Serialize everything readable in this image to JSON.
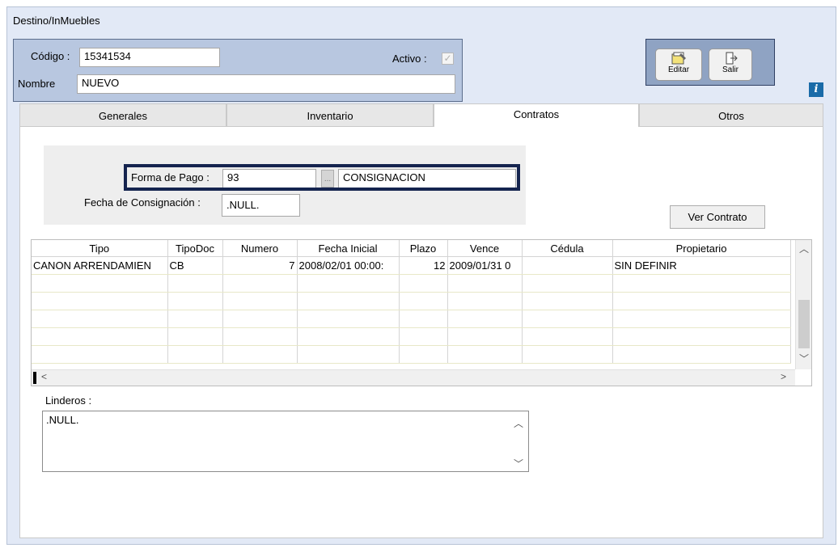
{
  "window": {
    "title": "Destino/InMuebles"
  },
  "header": {
    "codigo_label": "Código :",
    "codigo_value": "15341534",
    "activo_label": "Activo :",
    "activo_checked": true,
    "nombre_label": "Nombre",
    "nombre_value": "NUEVO"
  },
  "actions": {
    "edit_label": "Editar",
    "exit_label": "Salir"
  },
  "info_icon_glyph": "i",
  "tabs": [
    {
      "label": "Generales",
      "active": false
    },
    {
      "label": "Inventario",
      "active": false
    },
    {
      "label": "Contratos",
      "active": true
    },
    {
      "label": "Otros",
      "active": false
    }
  ],
  "payment": {
    "forma_label": "Forma de Pago :",
    "forma_code": "93",
    "ellipsis": "...",
    "forma_desc": "CONSIGNACION",
    "fecha_label": "Fecha de Consignación :",
    "fecha_value": ".NULL."
  },
  "ver_contrato_label": "Ver Contrato",
  "grid": {
    "columns": [
      "Tipo",
      "TipoDoc",
      "Numero",
      "Fecha Inicial",
      "Plazo",
      "Vence",
      "Cédula",
      "Propietario"
    ],
    "rows": [
      [
        "CANON ARRENDAMIEN",
        "CB",
        "7",
        "2008/02/01 00:00:",
        "12",
        "2009/01/31 0",
        "",
        "SIN DEFINIR"
      ],
      [
        "",
        "",
        "",
        "",
        "",
        "",
        "",
        ""
      ],
      [
        "",
        "",
        "",
        "",
        "",
        "",
        "",
        ""
      ],
      [
        "",
        "",
        "",
        "",
        "",
        "",
        "",
        ""
      ],
      [
        "",
        "",
        "",
        "",
        "",
        "",
        "",
        ""
      ],
      [
        "",
        "",
        "",
        "",
        "",
        "",
        "",
        ""
      ]
    ]
  },
  "linderos": {
    "label": "Linderos :",
    "value": ".NULL."
  },
  "colors": {
    "window_bg": "#e2e9f6",
    "header_bg": "#b8c7e0",
    "highlight": "#15244f",
    "info_icon": "#1a6ba8"
  }
}
